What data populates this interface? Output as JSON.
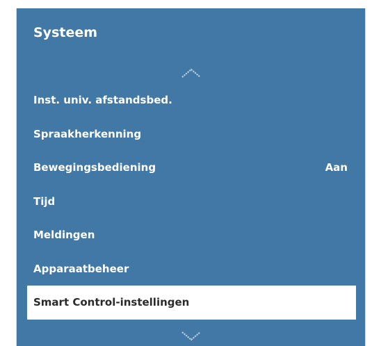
{
  "panel": {
    "title": "Systeem",
    "bg_color": "#4178a5",
    "scroll_up_icon": "chevron-up-icon",
    "scroll_down_icon": "chevron-down-icon"
  },
  "menu": {
    "items": [
      {
        "label": "Inst. univ. afstandsbed.",
        "value": ""
      },
      {
        "label": "Spraakherkenning",
        "value": ""
      },
      {
        "label": "Bewegingsbediening",
        "value": "Aan"
      },
      {
        "label": "Tijd",
        "value": ""
      },
      {
        "label": "Meldingen",
        "value": ""
      },
      {
        "label": "Apparaatbeheer",
        "value": ""
      },
      {
        "label": "Smart Control-instellingen",
        "value": "",
        "selected": true
      }
    ]
  }
}
